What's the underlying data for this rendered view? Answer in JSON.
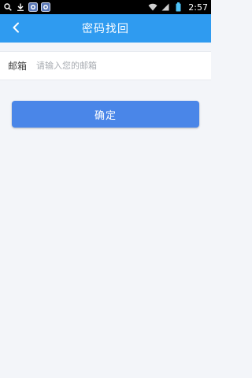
{
  "status_bar": {
    "time": "2:57",
    "icons": [
      "search-icon",
      "download-icon",
      "app-notification-icon",
      "app-notification-icon",
      "wifi-icon",
      "signal-icon",
      "battery-icon"
    ]
  },
  "header": {
    "title": "密码找回",
    "back_icon": "chevron-left-icon",
    "background": "#2f9bf0"
  },
  "form": {
    "email_label": "邮箱",
    "email_placeholder": "请输入您的邮箱",
    "email_value": ""
  },
  "actions": {
    "confirm_label": "确定",
    "confirm_color": "#4a86e8"
  }
}
